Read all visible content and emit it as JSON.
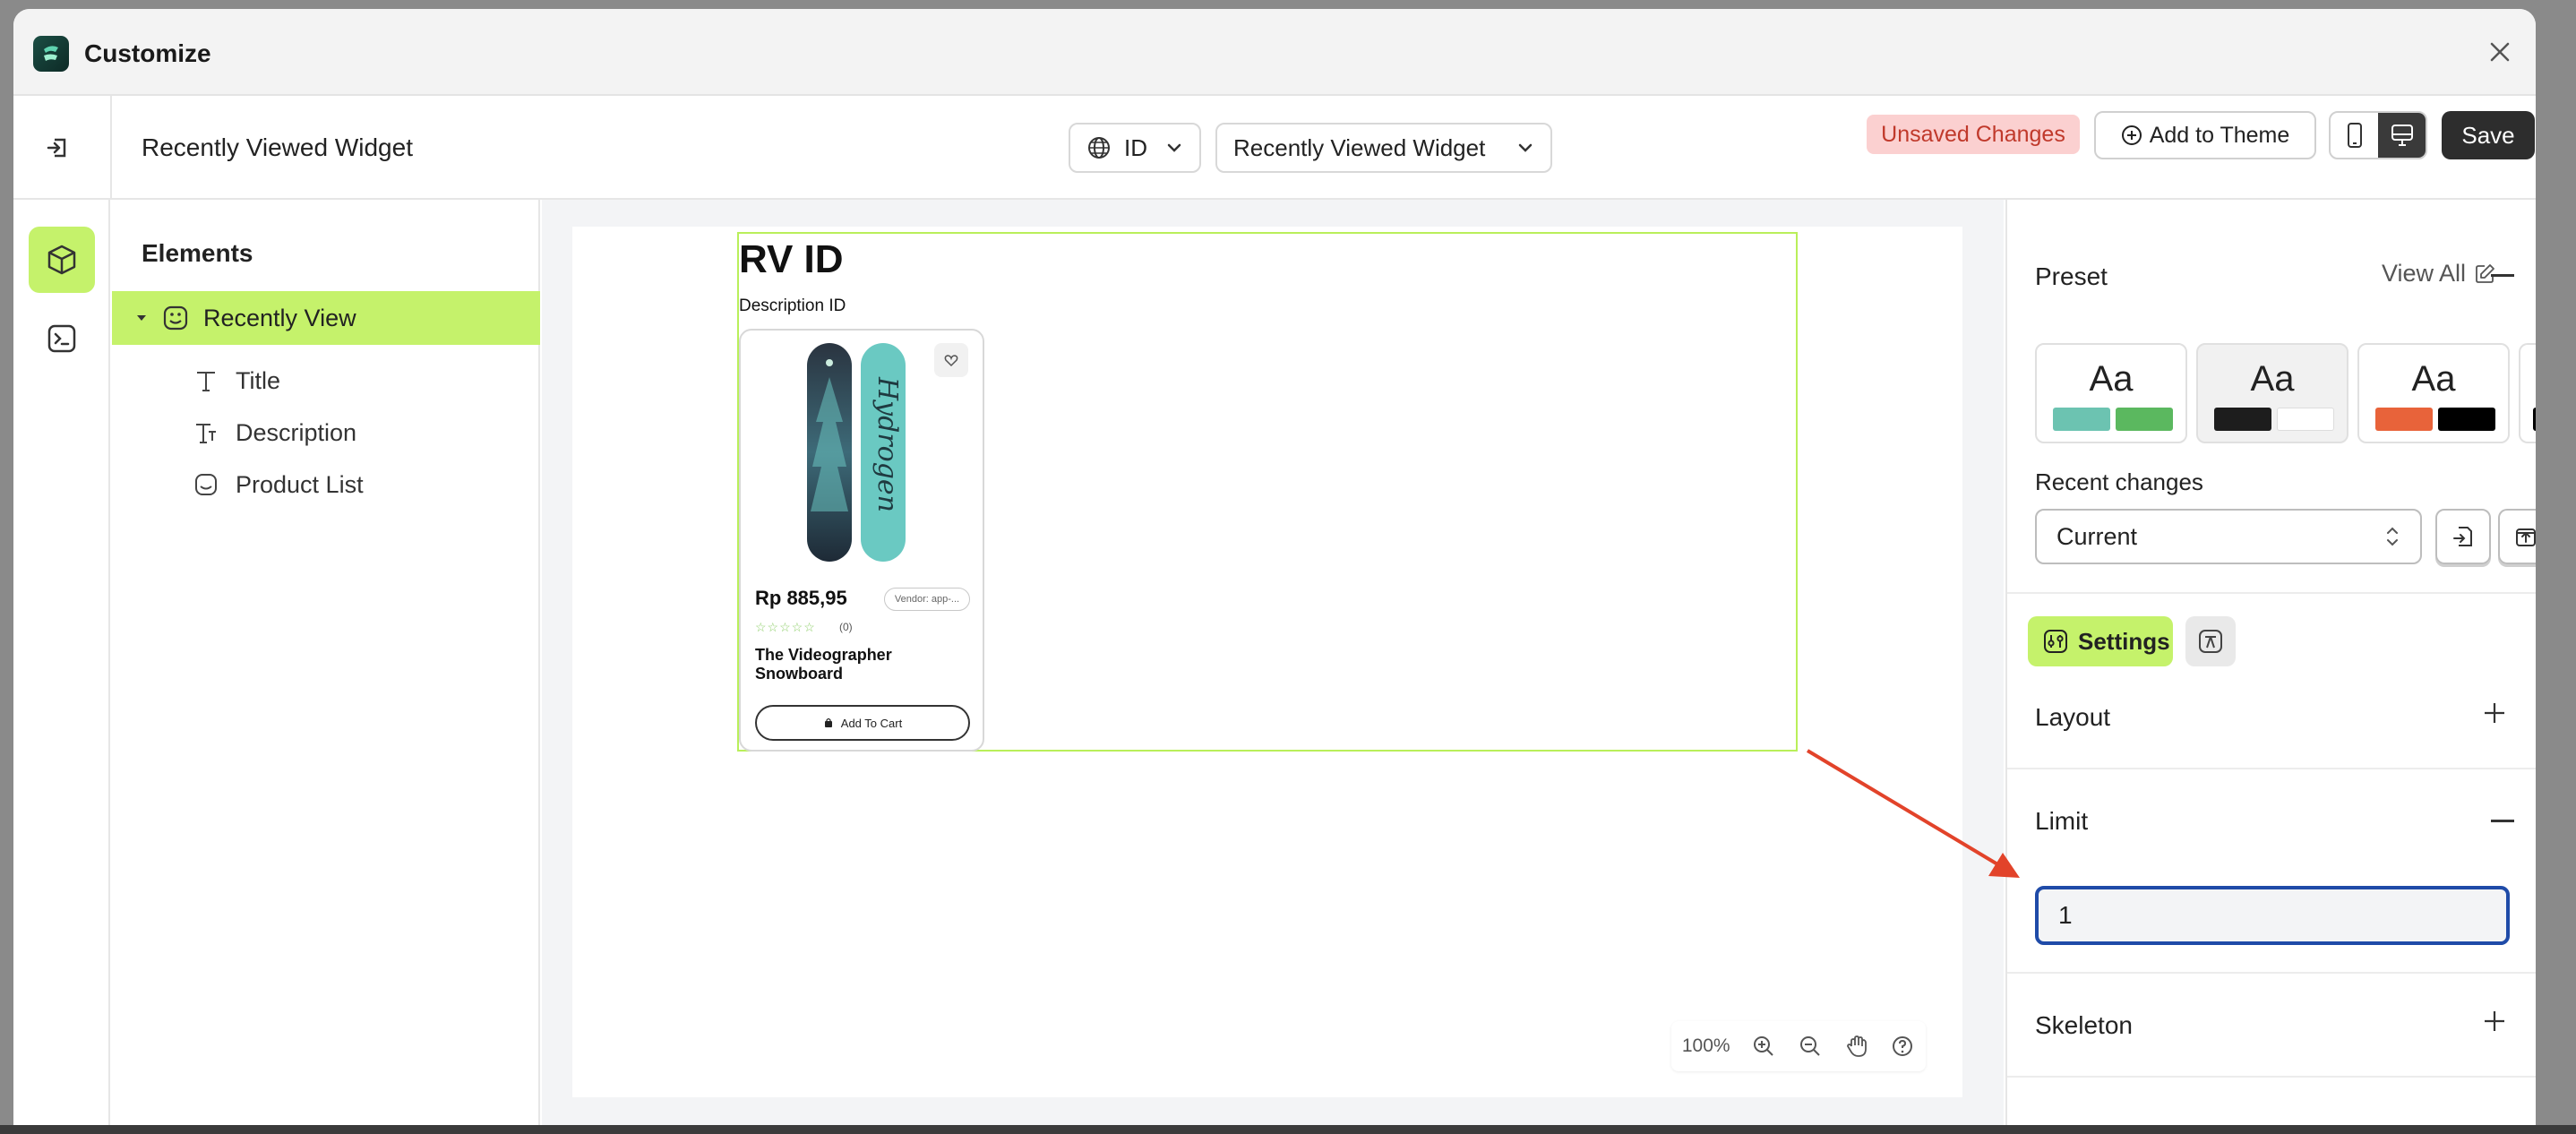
{
  "app": {
    "title": "Customize"
  },
  "header": {
    "page_name": "Recently Viewed Widget",
    "language": "ID",
    "page_select": "Recently Viewed Widget",
    "unsaved_badge": "Unsaved Changes",
    "add_to_theme": "Add to Theme",
    "save": "Save"
  },
  "elements_panel": {
    "title": "Elements",
    "root": "Recently View",
    "children": [
      "Title",
      "Description",
      "Product List"
    ]
  },
  "preview": {
    "title": "RV ID",
    "description": "Description ID",
    "product": {
      "price": "Rp 885,95",
      "vendor": "Vendor: app-...",
      "reviews": "(0)",
      "rating": 0,
      "name": "The Videographer Snowboard",
      "add_to_cart": "Add To Cart",
      "board_text": "Hydrogen"
    },
    "zoom": "100%"
  },
  "settings_panel": {
    "preset_label": "Preset",
    "view_all": "View All",
    "preset_glyph": "Aa",
    "presets": [
      {
        "colors": [
          "#6cc3b1",
          "#5bb85f"
        ]
      },
      {
        "colors": [
          "#1d1d1d",
          "#ffffff"
        ]
      },
      {
        "colors": [
          "#e8633a",
          "#000000"
        ]
      }
    ],
    "recent_changes_label": "Recent changes",
    "recent_changes_value": "Current",
    "settings_tab": "Settings",
    "layout_label": "Layout",
    "limit_label": "Limit",
    "limit_value": "1",
    "skeleton_label": "Skeleton"
  },
  "colors": {
    "accent": "#c5f26b",
    "save_bg": "#2d2d2d",
    "unsaved_bg": "#fbd0d0",
    "unsaved_text": "#c0392b",
    "focus_border": "#1f4ba8",
    "annotation_arrow": "#e2432a"
  }
}
